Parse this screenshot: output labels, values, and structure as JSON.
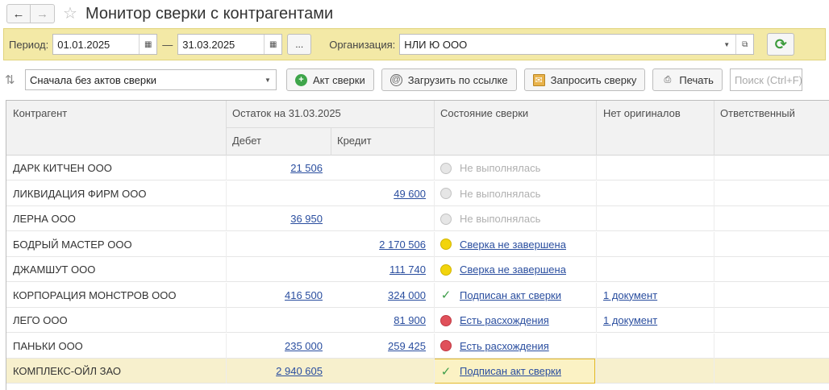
{
  "window": {
    "title": "Монитор сверки с контрагентами",
    "back_glyph": "←",
    "forward_glyph": "→",
    "star_glyph": "☆"
  },
  "filters": {
    "period_label": "Период:",
    "date_from": "01.01.2025",
    "date_separator": "—",
    "date_to": "31.03.2025",
    "more_label": "...",
    "org_label": "Организация:",
    "org_value": "НЛИ Ю ООО",
    "refresh_glyph": "⟳"
  },
  "toolbar": {
    "sort_glyph": "⇅",
    "sort_value": "Сначала без актов сверки",
    "act_button": "Акт сверки",
    "load_button": "Загрузить по ссылке",
    "request_button": "Запросить сверку",
    "print_button": "Печать",
    "search_placeholder": "Поиск (Ctrl+F)"
  },
  "table": {
    "headers": {
      "counterparty": "Контрагент",
      "balance": "Остаток на 31.03.2025",
      "debit": "Дебет",
      "credit": "Кредит",
      "state": "Состояние сверки",
      "no_originals": "Нет оригиналов",
      "responsible": "Ответственный"
    },
    "rows": [
      {
        "name": "ДАРК КИТЧЕН ООО",
        "debit": "21 506",
        "credit": "",
        "state": "Не выполнялась",
        "docs": ""
      },
      {
        "name": "ЛИКВИДАЦИЯ ФИРМ ООО",
        "debit": "",
        "credit": "49 600",
        "state": "Не выполнялась",
        "docs": ""
      },
      {
        "name": "ЛЕРНА ООО",
        "debit": "36 950",
        "credit": "",
        "state": "Не выполнялась",
        "docs": ""
      },
      {
        "name": "БОДРЫЙ МАСТЕР ООО",
        "debit": "",
        "credit": "2 170 506",
        "state": "Сверка не завершена",
        "docs": ""
      },
      {
        "name": "ДЖАМШУТ ООО",
        "debit": "",
        "credit": "111 740",
        "state": "Сверка не завершена",
        "docs": ""
      },
      {
        "name": "КОРПОРАЦИЯ МОНСТРОВ ООО",
        "debit": "416 500",
        "credit": "324 000",
        "state": "Подписан акт сверки",
        "docs": "1 документ"
      },
      {
        "name": "ЛЕГО ООО",
        "debit": "",
        "credit": "81 900",
        "state": "Есть расхождения",
        "docs": "1 документ"
      },
      {
        "name": "ПАНЬКИ ООО",
        "debit": "235 000",
        "credit": "259 425",
        "state": "Есть расхождения",
        "docs": ""
      },
      {
        "name": "КОМПЛЕКС-ОЙЛ ЗАО",
        "debit": "2 940 605",
        "credit": "",
        "state": "Подписан акт сверки",
        "docs": ""
      }
    ]
  },
  "colors": {
    "filter_bg": "#f3e9a6",
    "link": "#2a4e9f",
    "status_gray": "#e6e6e6",
    "status_yellow": "#f2d40c",
    "status_red": "#e0505a",
    "status_green": "#3e9d4a",
    "selected_row": "#f7f0cd"
  }
}
